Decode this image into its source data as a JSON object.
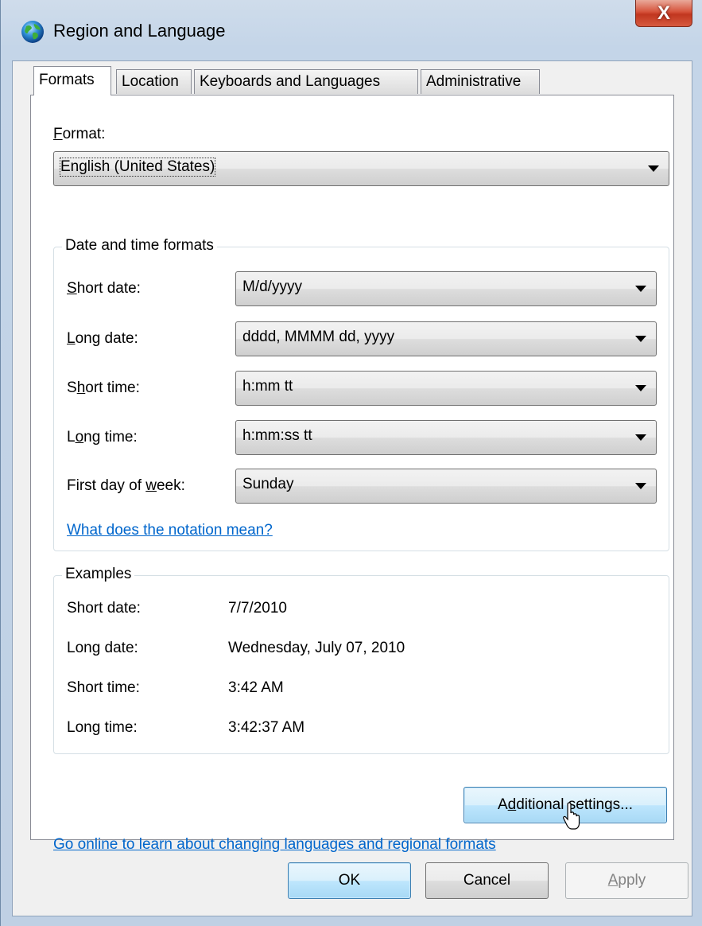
{
  "window": {
    "title": "Region and Language",
    "close_label": "X"
  },
  "tabs": [
    {
      "label": "Formats"
    },
    {
      "label": "Location"
    },
    {
      "label": "Keyboards and Languages"
    },
    {
      "label": "Administrative"
    }
  ],
  "format": {
    "label_pre": "",
    "label_mnemonic": "F",
    "label_post": "ormat:",
    "value": "English (United States)"
  },
  "date_time_formats": {
    "title": "Date and time formats",
    "rows": [
      {
        "pre": "",
        "mn": "S",
        "post": "hort date:",
        "value": "M/d/yyyy"
      },
      {
        "pre": "",
        "mn": "L",
        "post": "ong date:",
        "value": "dddd, MMMM dd, yyyy"
      },
      {
        "pre": "S",
        "mn": "h",
        "post": "ort time:",
        "value": "h:mm tt"
      },
      {
        "pre": "L",
        "mn": "o",
        "post": "ng time:",
        "value": "h:mm:ss tt"
      },
      {
        "pre": "First day of ",
        "mn": "w",
        "post": "eek:",
        "value": "Sunday"
      }
    ],
    "link": "What does the notation mean?"
  },
  "examples": {
    "title": "Examples",
    "rows": [
      {
        "label": "Short date:",
        "value": "7/7/2010"
      },
      {
        "label": "Long date:",
        "value": "Wednesday, July 07, 2010"
      },
      {
        "label": "Short time:",
        "value": "3:42 AM"
      },
      {
        "label": "Long time:",
        "value": "3:42:37 AM"
      }
    ]
  },
  "additional_settings": {
    "pre": "A",
    "mn": "d",
    "post": "ditional settings..."
  },
  "online_link": "Go online to learn about changing languages and regional formats",
  "buttons": {
    "ok": "OK",
    "cancel": "Cancel",
    "apply_mn": "A",
    "apply_post": "pply"
  },
  "icons": [
    "globe-icon",
    "close-icon",
    "dropdown-arrow-icon",
    "mouse-cursor-icon"
  ]
}
